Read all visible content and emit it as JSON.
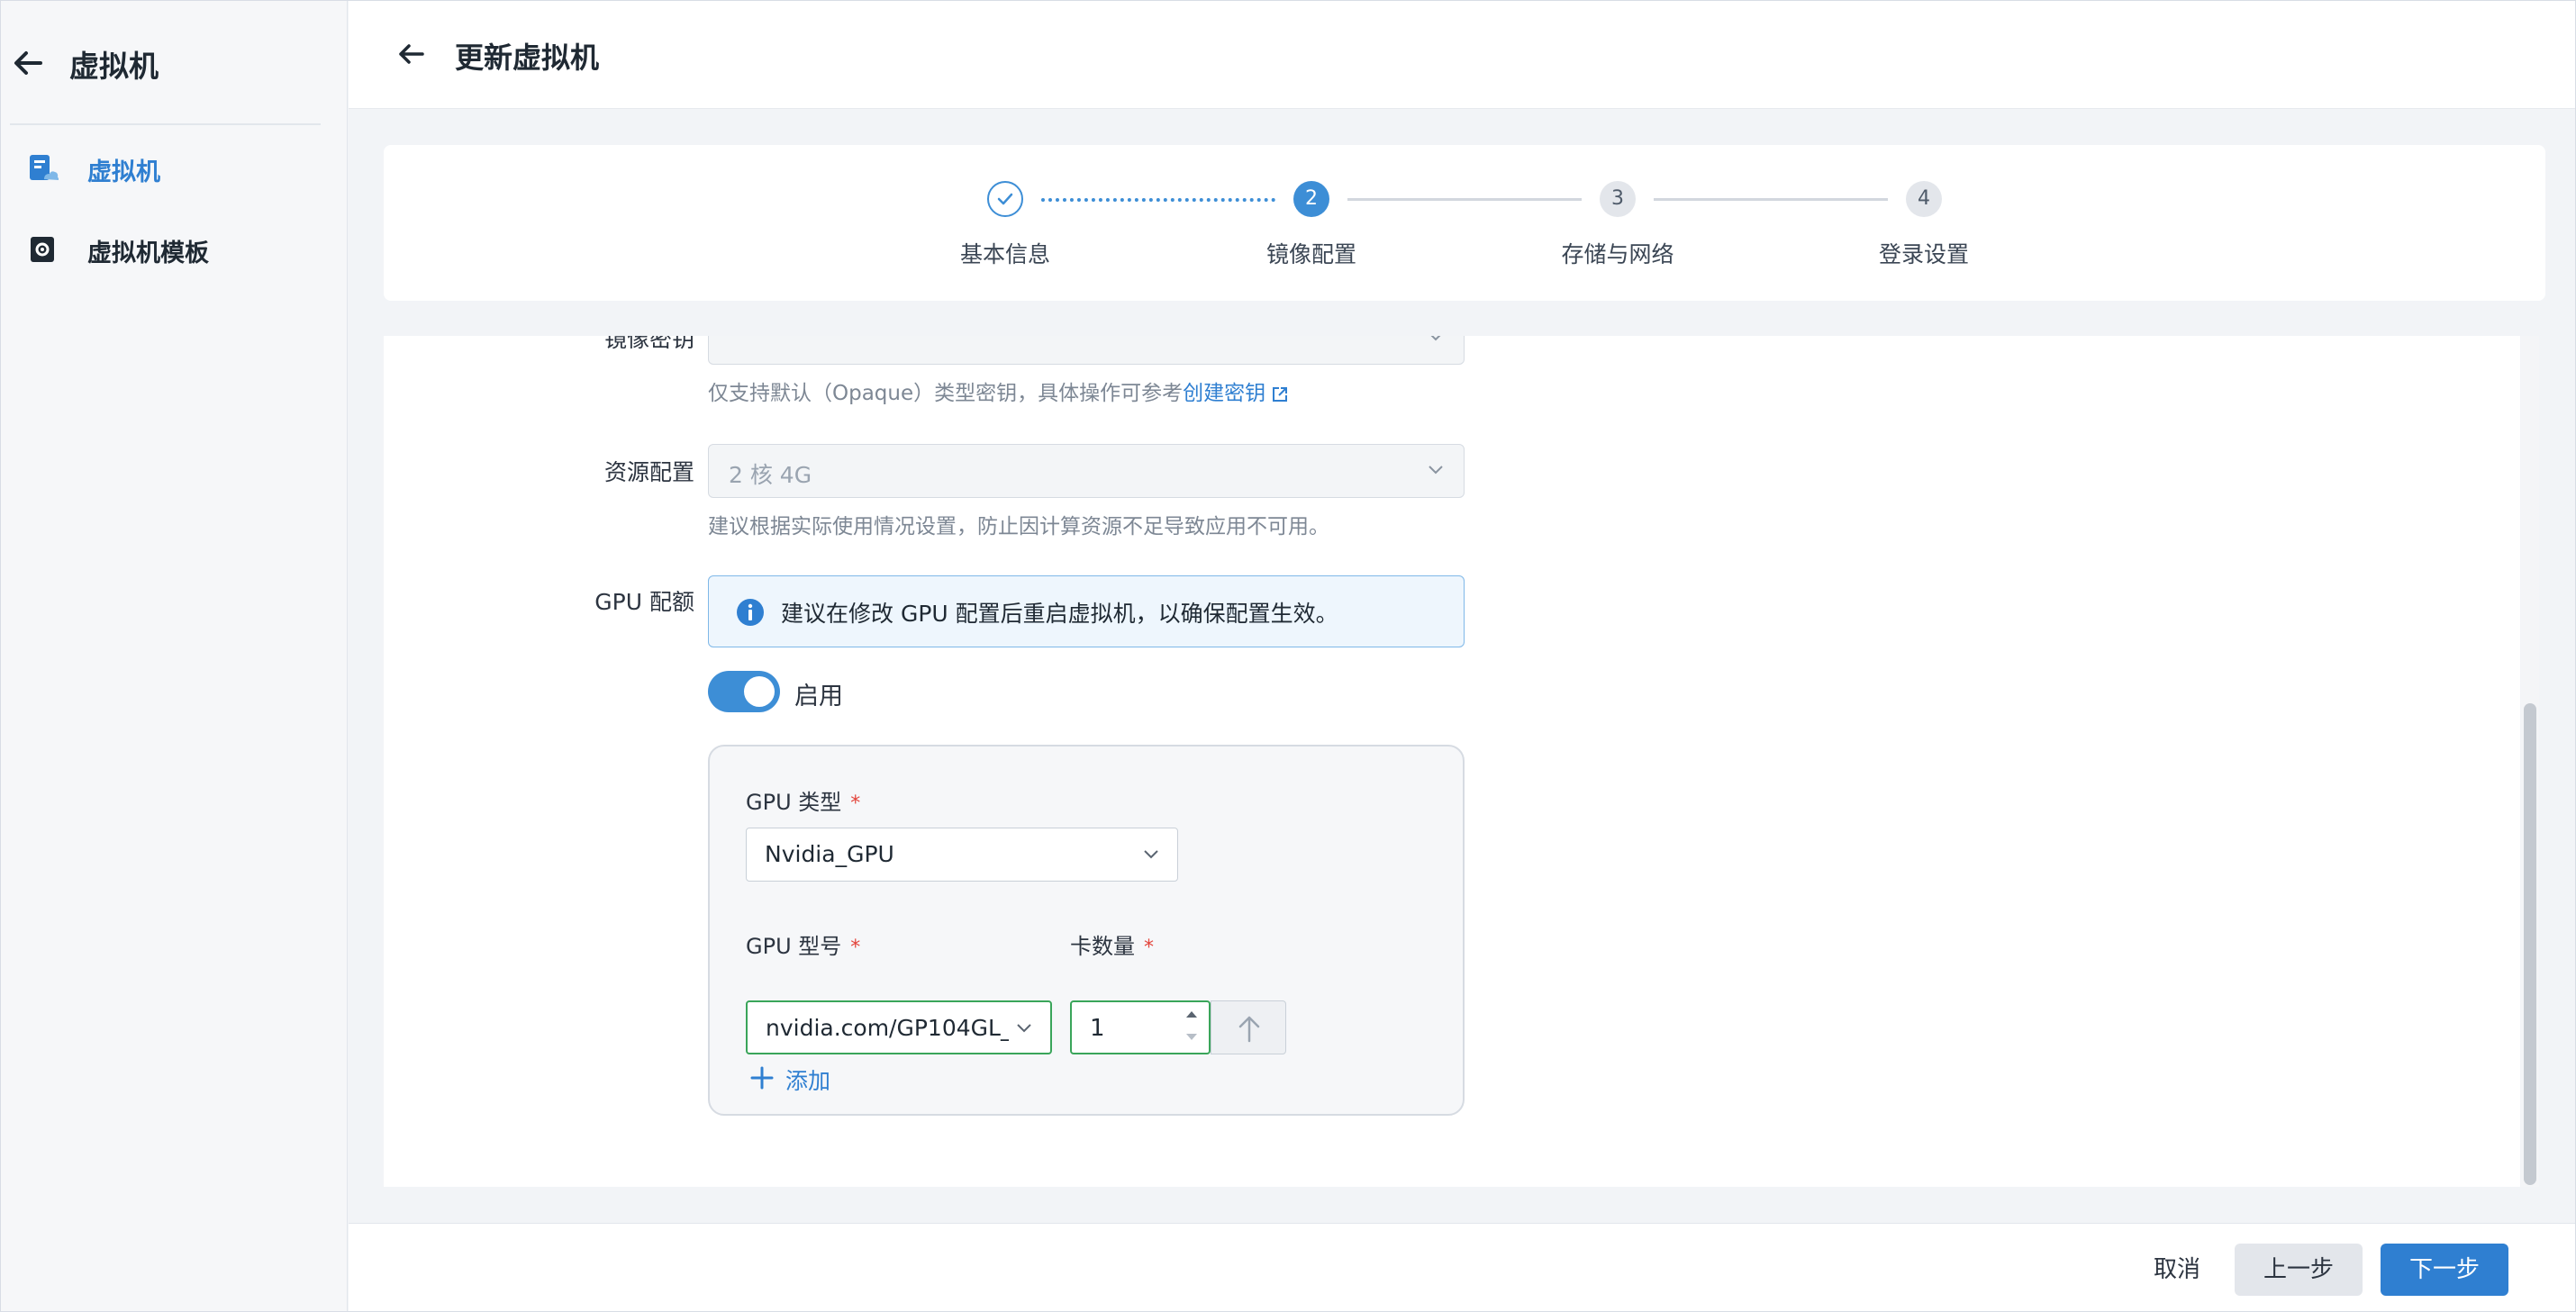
{
  "sidebar": {
    "title": "虚拟机",
    "items": [
      {
        "label": "虚拟机",
        "icon": "vm-icon",
        "active": true
      },
      {
        "label": "虚拟机模板",
        "icon": "vm-template-icon",
        "active": false
      }
    ]
  },
  "header": {
    "title": "更新虚拟机"
  },
  "steps": [
    {
      "label": "基本信息",
      "status": "done",
      "number": ""
    },
    {
      "label": "镜像配置",
      "status": "active",
      "number": "2"
    },
    {
      "label": "存储与网络",
      "status": "todo",
      "number": "3"
    },
    {
      "label": "登录设置",
      "status": "todo",
      "number": "4"
    }
  ],
  "form": {
    "image_secret": {
      "label": "镜像密钥",
      "value": "",
      "hint_prefix": "仅支持默认（Opaque）类型密钥，具体操作可参考",
      "hint_link": "创建密钥"
    },
    "resource": {
      "label": "资源配置",
      "value": "2 核 4G",
      "hint": "建议根据实际使用情况设置，防止因计算资源不足导致应用不可用。"
    },
    "gpu": {
      "label": "GPU 配额",
      "alert": "建议在修改 GPU 配置后重启虚拟机，以确保配置生效。",
      "toggle_label": "启用",
      "enabled": true,
      "type_label": "GPU 类型",
      "type_value": "Nvidia_GPU",
      "model_label": "GPU 型号",
      "model_value": "nvidia.com/GP104GL_",
      "count_label": "卡数量",
      "count_value": "1",
      "add_label": "添加",
      "required_mark": "*"
    }
  },
  "footer": {
    "cancel": "取消",
    "prev": "上一步",
    "next": "下一步"
  },
  "colors": {
    "accent": "#2f7fd1",
    "success_border": "#3aa55a",
    "required": "#e3443b",
    "alert_bg": "#eef6fd"
  }
}
